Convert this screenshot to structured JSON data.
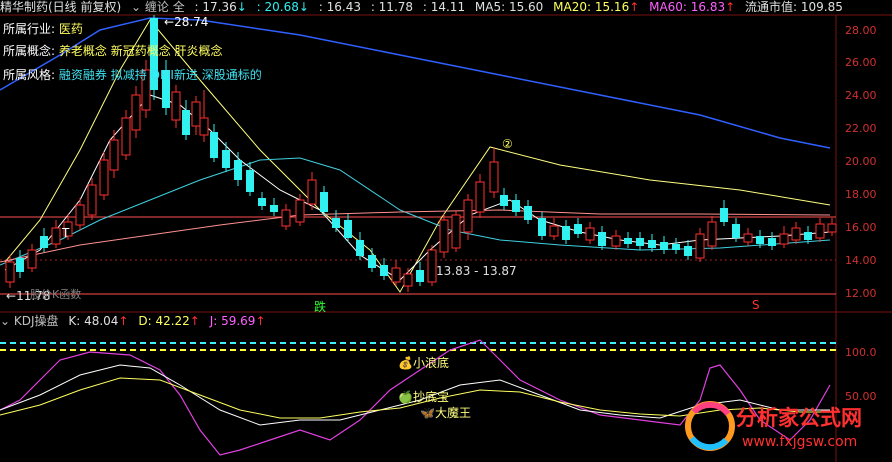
{
  "header": {
    "stock_name": "精华制药(日线 前复权)",
    "indicator": "缠论 全",
    "v1": "17.36",
    "v2": "20.68",
    "v3": "16.43",
    "v4": "11.78",
    "v5": "14.11",
    "ma5": "MA5: 15.60",
    "ma20": "MA20: 15.16",
    "ma60": "MA60: 16.83",
    "float_cap": "流通市值: 109.85",
    "arrow_up": "↑",
    "arrow_down": "↓"
  },
  "info": {
    "industry_label": "所属行业:",
    "industry": "医药",
    "concept_label": "所属概念:",
    "concept": "养老概念 新冠药概念 肝炎概念",
    "style_label": "所属风格:",
    "style": "融资融券 拟减持 QFII新进 深股通标的"
  },
  "annotations": {
    "high": "28.74",
    "low": "11.78",
    "range": "13.83 - 13.87",
    "marker2": "②",
    "t_mark": "T",
    "die": "跌",
    "s_mark": "S",
    "small_label": "股价K函数"
  },
  "price_axis": [
    "28.00",
    "26.00",
    "24.00",
    "22.00",
    "20.00",
    "18.00",
    "16.00",
    "14.00",
    "12.00"
  ],
  "kdj": {
    "title": "KDJ操盘",
    "k": "K: 48.04",
    "d": "D: 42.22",
    "j": "J: 59.69",
    "axis": [
      "100.0",
      "50.00"
    ],
    "labels": {
      "l1": "小浪底",
      "l2": "抄底宝",
      "l3": "大魔王"
    }
  },
  "watermark": {
    "cn": "分析家公式网",
    "url": "www.fxjgsw.com"
  },
  "colors": {
    "up": "#ff3030",
    "down": "#30f0f0",
    "ma5": "#ffffff",
    "ma20": "#ffff60",
    "ma60": "#ff60ff",
    "blue_line": "#3060ff"
  }
}
